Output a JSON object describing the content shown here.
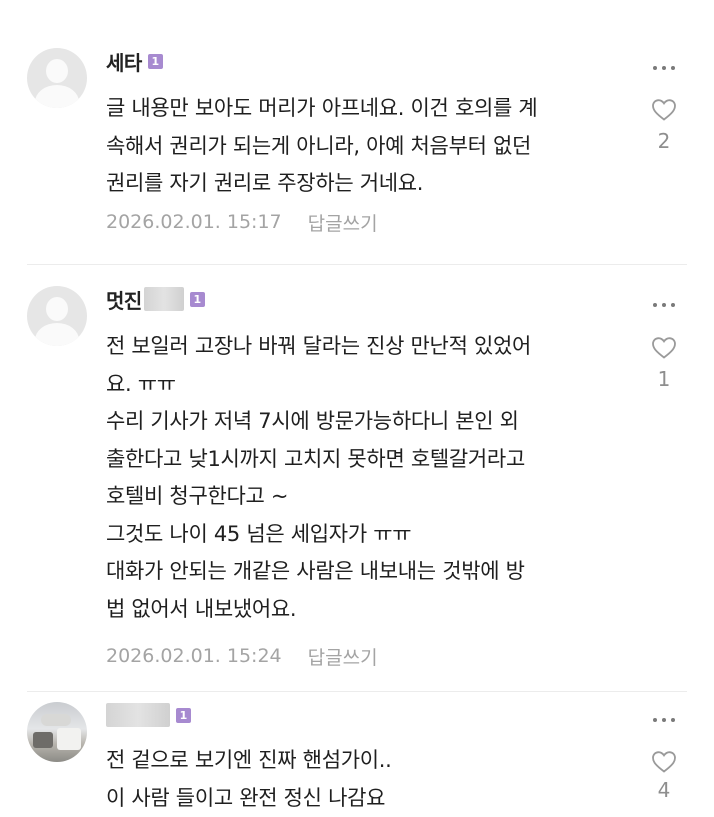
{
  "comments": [
    {
      "nickname": "세타",
      "level_badge": "1",
      "lines": [
        "글 내용만 보아도 머리가 아프네요. 이건 호의를 계",
        "속해서 권리가 되는게 아니라, 아예 처음부터 없던",
        "권리를 자기 권리로 주장하는 거네요."
      ],
      "timestamp": "2026.02.01. 15:17",
      "reply_label": "답글쓰기",
      "like_count": "2",
      "avatar_icon": "default-profile-icon"
    },
    {
      "nickname": "멋진",
      "level_badge": "1",
      "lines": [
        "전 보일러 고장나 바꿔 달라는 진상 만난적 있었어",
        "요. ㅠㅠ",
        "수리 기사가 저녁 7시에 방문가능하다니 본인 외",
        "출한다고 낮1시까지 고치지 못하면 호텔갈거라고",
        "호텔비 청구한다고 ~",
        "그것도 나이 45 넘은 세입자가 ㅠㅠ",
        "대화가 안되는 개같은 사람은 내보내는 것밖에 방",
        "법 없어서 내보냈어요."
      ],
      "timestamp": "2026.02.01. 15:24",
      "reply_label": "답글쓰기",
      "like_count": "1",
      "avatar_icon": "default-profile-icon"
    },
    {
      "nickname": "",
      "level_badge": "1",
      "lines": [
        "전 겉으로 보기엔 진짜 핸섬가이..",
        "이 사람 들이고 완전 정신 나감요"
      ],
      "like_count": "4",
      "avatar_icon": "photo-profile-icon"
    }
  ],
  "colors": {
    "text": "#1f1f1f",
    "meta": "#a4a4a4",
    "badge": "#a78ad0",
    "heart_outline": "#9a9a9a"
  }
}
